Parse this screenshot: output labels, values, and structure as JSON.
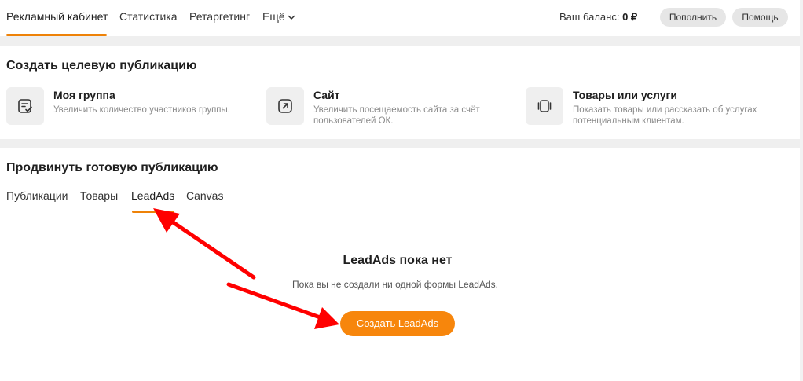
{
  "nav": {
    "items": [
      {
        "label": "Рекламный кабинет",
        "active": true
      },
      {
        "label": "Статистика",
        "active": false
      },
      {
        "label": "Ретаргетинг",
        "active": false
      },
      {
        "label": "Ещё",
        "active": false
      }
    ],
    "balance_label": "Ваш баланс:",
    "balance_value": "0 ₽",
    "topup_label": "Пополнить",
    "help_label": "Помощь"
  },
  "create": {
    "title": "Создать целевую публикацию",
    "cards": [
      {
        "title": "Моя группа",
        "desc": "Увеличить количество участников группы.",
        "icon": "group-post-icon"
      },
      {
        "title": "Сайт",
        "desc": "Увеличить посещаемость сайта за счёт пользователей ОК.",
        "icon": "external-link-icon"
      },
      {
        "title": "Товары или услуги",
        "desc": "Показать товары или рассказать об услугах потенциальным клиентам.",
        "icon": "products-carousel-icon"
      }
    ]
  },
  "promote": {
    "title": "Продвинуть готовую публикацию",
    "tabs": [
      {
        "label": "Публикации",
        "active": false
      },
      {
        "label": "Товары",
        "active": false
      },
      {
        "label": "LeadAds",
        "active": true
      },
      {
        "label": "Canvas",
        "active": false
      }
    ]
  },
  "empty": {
    "title": "LeadAds пока нет",
    "desc": "Пока вы не создали ни одной формы LeadAds.",
    "cta_label": "Создать LeadAds"
  },
  "colors": {
    "accent": "#ee8208",
    "button": "#f7860c",
    "annotation": "#ff0000"
  }
}
